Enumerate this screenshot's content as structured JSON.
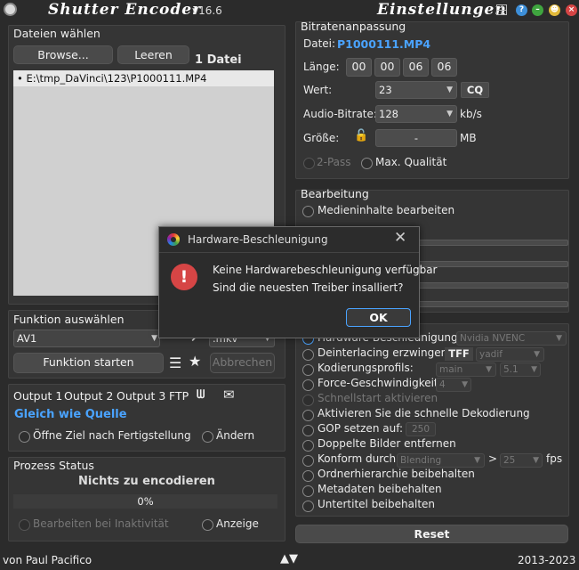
{
  "app": {
    "brand": "Shutter Encoder",
    "version": "v16.6",
    "settings_label": "Einstellungen",
    "footer_author": "von Paul Pacifico",
    "footer_years": "2013-2023"
  },
  "files": {
    "title": "Dateien wählen",
    "browse": "Browse...",
    "clear": "Leeren",
    "count": "1 Datei",
    "items": [
      "E:\\tmp_DaVinci\\123\\P1000111.MP4"
    ]
  },
  "function": {
    "title": "Funktion auswählen",
    "selected": "AV1",
    "container": ".mkv",
    "start": "Funktion starten",
    "cancel": "Abbrechen"
  },
  "output": {
    "tabs": [
      "Output 1",
      "Output 2",
      "Output 3",
      "FTP"
    ],
    "same_as_source": "Gleich wie Quelle",
    "open_dest": "Öffne Ziel nach Fertigstellung",
    "change": "Ändern"
  },
  "status": {
    "title": "Prozess Status",
    "text": "Nichts zu encodieren",
    "percent": "0%",
    "progress": 0,
    "edit_idle": "Bearbeiten bei Inaktivität",
    "display": "Anzeige"
  },
  "bitrate": {
    "title": "Bitratenanpassung",
    "file_label": "Datei:",
    "file_name": "P1000111.MP4",
    "length_label": "Länge:",
    "length": [
      "00",
      "00",
      "06",
      "06"
    ],
    "value_label": "Wert:",
    "value": "23",
    "cq": "CQ",
    "audio_label": "Audio-Bitrate:",
    "audio": "128",
    "audio_unit": "kb/s",
    "size_label": "Größe:",
    "size_value": "-",
    "size_unit": "MB",
    "two_pass": "2-Pass",
    "max_quality": "Max. Qualität"
  },
  "edit": {
    "title": "Bearbeitung",
    "media": "Medieninhalte bearbeiten"
  },
  "advanced": {
    "hw_accel": "Hardware-Beschleunigung:",
    "hw_value": "Nvidia NVENC",
    "deint": "Deinterlacing erzwingen:",
    "deint_field": "TFF",
    "deint_mode": "yadif",
    "profile": "Kodierungsprofils:",
    "profile_value": "main",
    "profile_level": "5.1",
    "speed": "Force-Geschwindigkeit:",
    "speed_value": "4",
    "fast_start": "Schnellstart aktivieren",
    "fast_decode": "Aktivieren Sie die schnelle Dekodierung",
    "gop": "GOP setzen auf:",
    "gop_value": "250",
    "dup": "Doppelte Bilder entfernen",
    "conform": "Konform durch:",
    "conform_value": "Blending",
    "conform_gt": ">",
    "conform_fps": "25",
    "fps": "fps",
    "keep_folders": "Ordnerhierarchie beibehalten",
    "keep_meta": "Metadaten beibehalten",
    "keep_subs": "Untertitel beibehalten",
    "reset": "Reset"
  },
  "dialog": {
    "title": "Hardware-Beschleunigung",
    "line1": "Keine Hardwarebeschleunigung verfügbar",
    "line2": "Sind die neuesten Treiber insalliert?",
    "ok": "OK"
  },
  "colors": {
    "accent": "#4aa3ff",
    "error": "#d64545"
  }
}
